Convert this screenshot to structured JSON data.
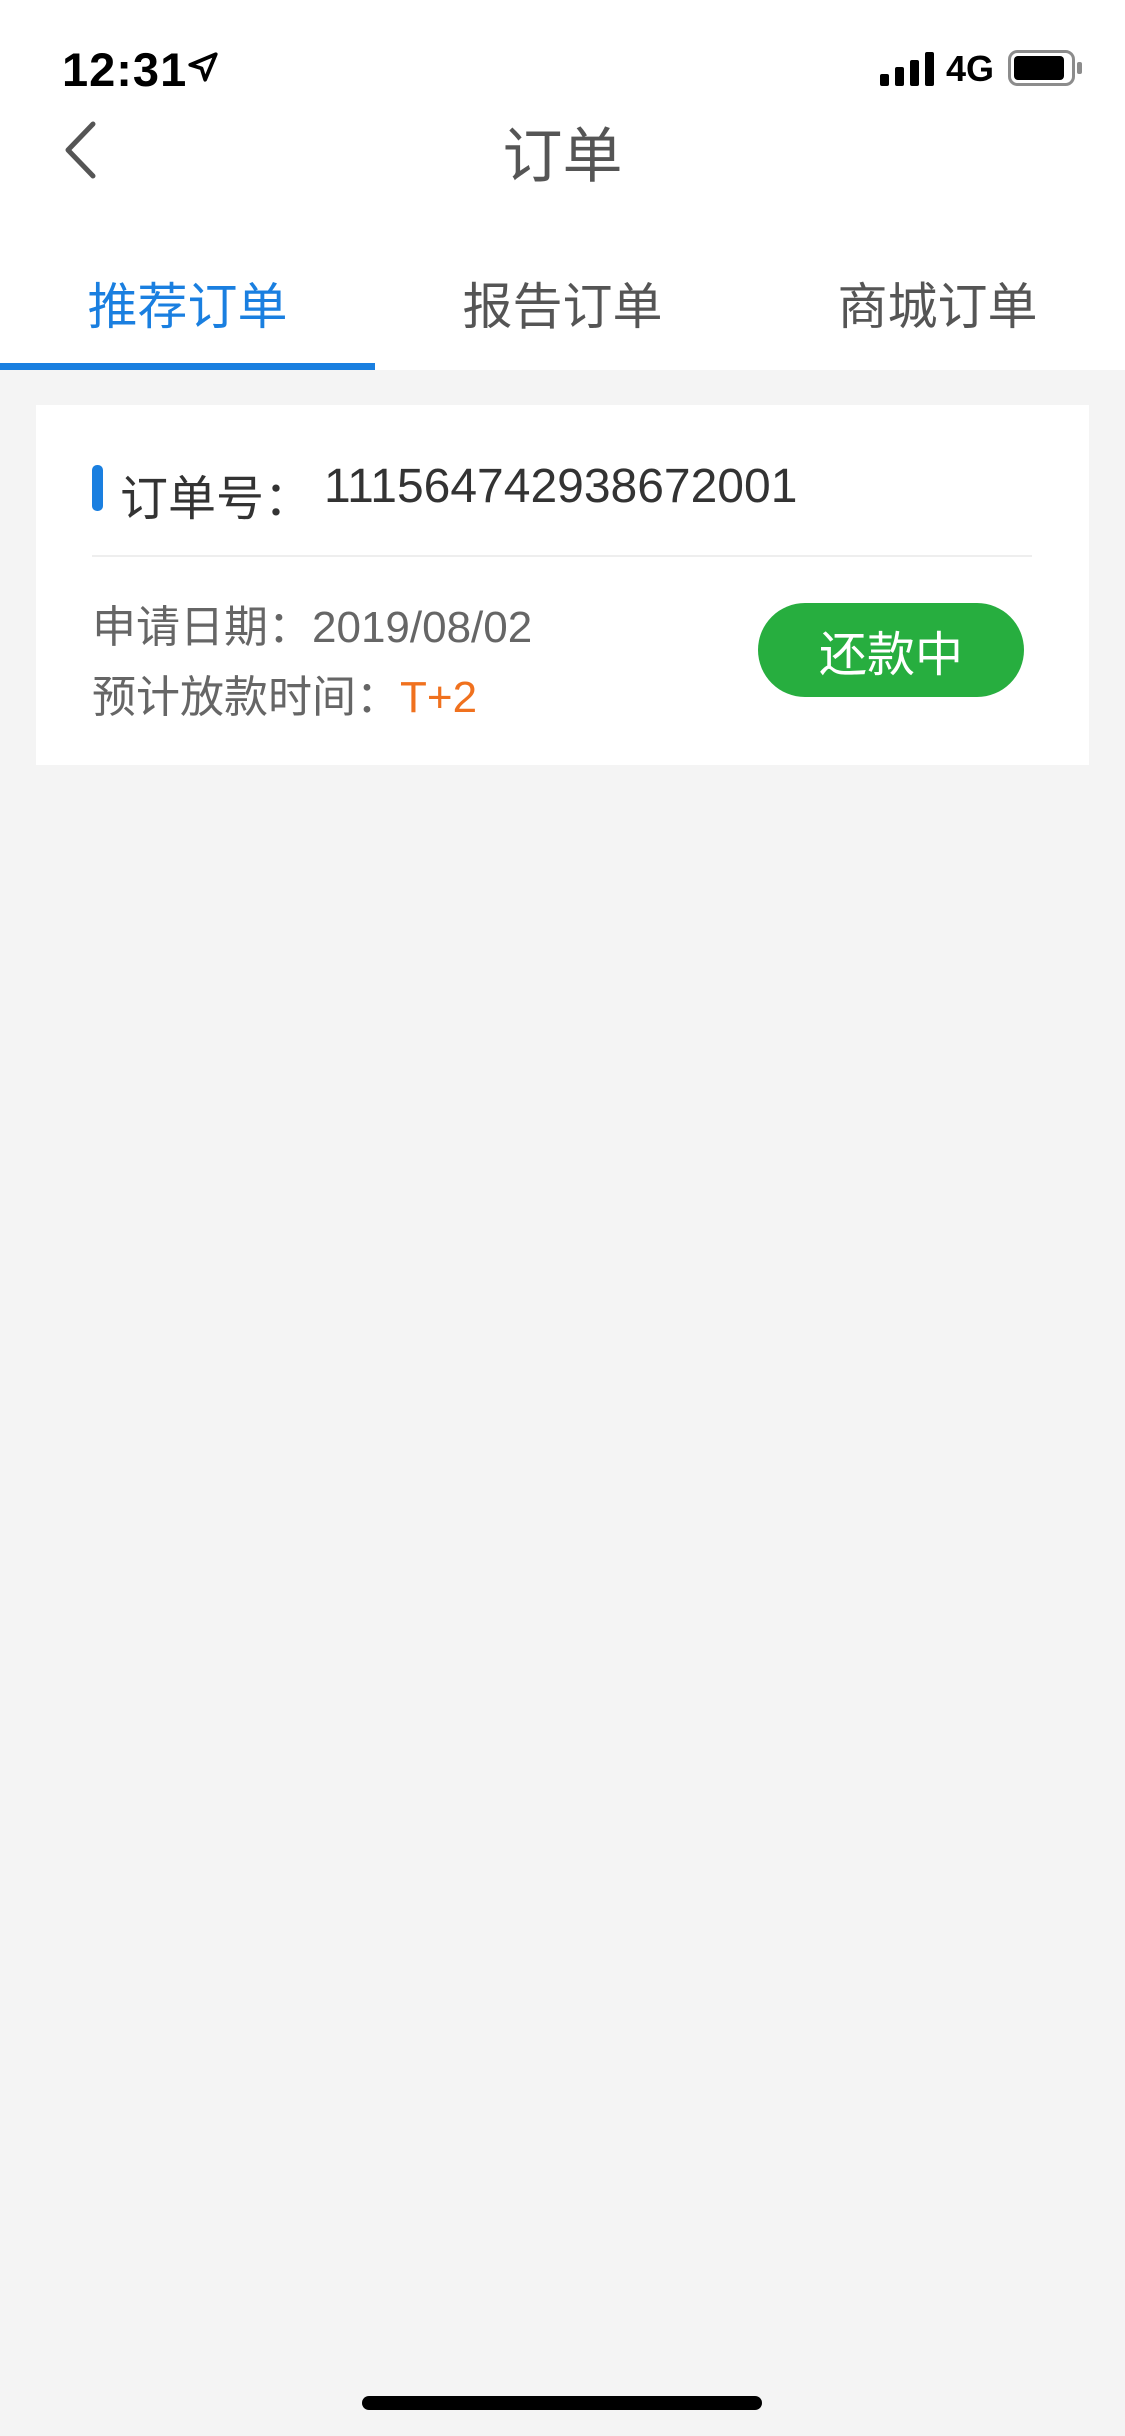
{
  "status_bar": {
    "time": "12:31",
    "network": "4G"
  },
  "nav": {
    "title": "订单"
  },
  "tabs": [
    {
      "label": "推荐订单",
      "active": true
    },
    {
      "label": "报告订单",
      "active": false
    },
    {
      "label": "商城订单",
      "active": false
    }
  ],
  "order": {
    "number_label": "订单号：",
    "number_value": "111564742938672001",
    "apply_date_label": "申请日期：",
    "apply_date_value": "2019/08/02",
    "expected_label": "预计放款时间：",
    "expected_value": "T+2",
    "status_label": "还款中"
  },
  "colors": {
    "accent": "#1a7fe0",
    "status_green": "#27ae3f",
    "highlight_orange": "#f0711e",
    "background": "#f4f4f4"
  }
}
